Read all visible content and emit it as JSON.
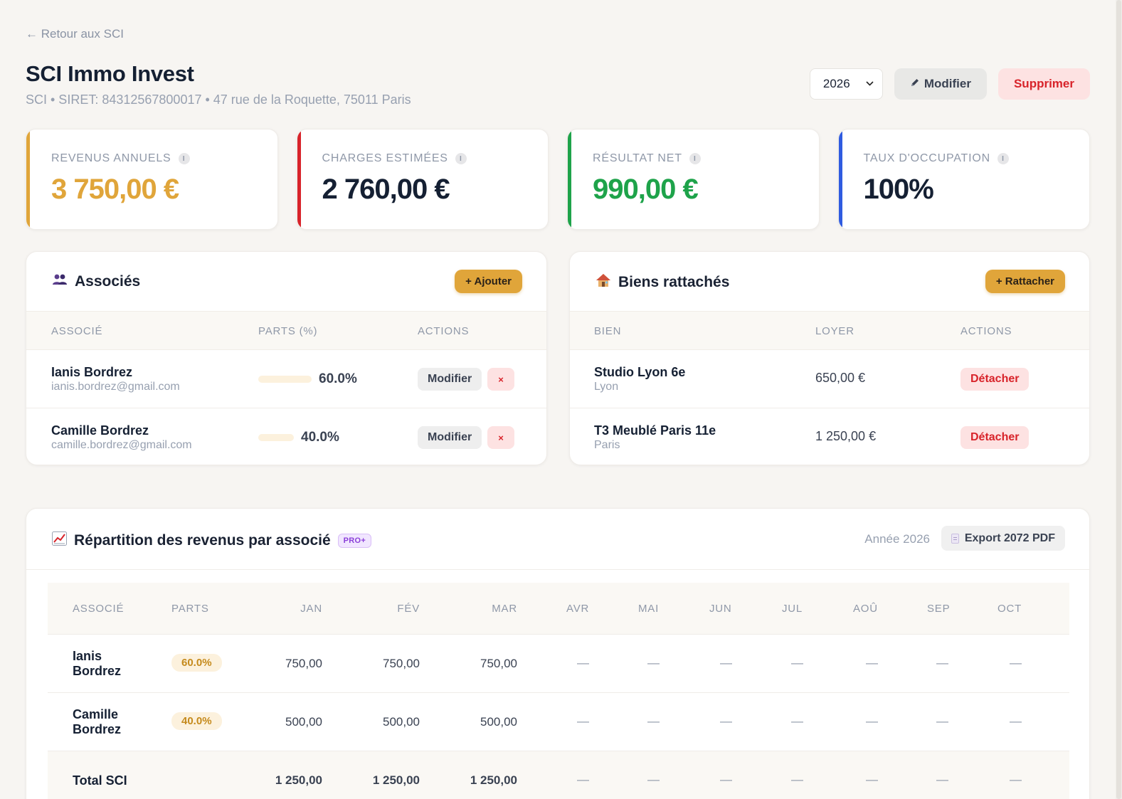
{
  "nav": {
    "back_label": "← Retour aux SCI"
  },
  "header": {
    "title": "SCI Immo Invest",
    "subtitle": "SCI • SIRET: 84312567800017 • 47 rue de la Roquette, 75011 Paris",
    "year_selected": "2026",
    "edit_label": "Modifier",
    "delete_label": "Supprimer"
  },
  "kpis": [
    {
      "label": "Revenus annuels",
      "value": "3 750,00 €",
      "accent": "#e0a53a",
      "value_color": "#e0a53a"
    },
    {
      "label": "Charges estimées",
      "value": "2 760,00 €",
      "accent": "#d8232a",
      "value_color": "#152033"
    },
    {
      "label": "Résultat net",
      "value": "990,00 €",
      "accent": "#1ea34a",
      "value_color": "#1ea34a"
    },
    {
      "label": "Taux d'occupation",
      "value": "100%",
      "accent": "#2f5be0",
      "value_color": "#152033"
    }
  ],
  "associes": {
    "title": "Associés",
    "icon": "people-icon",
    "add_label": "+ Ajouter",
    "columns": [
      "Associé",
      "Parts (%)",
      "Actions"
    ],
    "rows": [
      {
        "name": "Ianis Bordrez",
        "email": "ianis.bordrez@gmail.com",
        "share": 60.0,
        "share_label": "60.0%",
        "edit_label": "Modifier",
        "remove_label": "×"
      },
      {
        "name": "Camille Bordrez",
        "email": "camille.bordrez@gmail.com",
        "share": 40.0,
        "share_label": "40.0%",
        "edit_label": "Modifier",
        "remove_label": "×"
      }
    ]
  },
  "biens": {
    "title": "Biens rattachés",
    "icon": "house-icon",
    "add_label": "+ Rattacher",
    "columns": [
      "Bien",
      "Loyer",
      "Actions"
    ],
    "rows": [
      {
        "name": "Studio Lyon 6e",
        "city": "Lyon",
        "rent": "650,00 €",
        "detach_label": "Détacher"
      },
      {
        "name": "T3 Meublé Paris 11e",
        "city": "Paris",
        "rent": "1 250,00 €",
        "detach_label": "Détacher"
      }
    ]
  },
  "repartition": {
    "title": "Répartition des revenus par associé",
    "icon": "chart-icon",
    "badge": "PRO+",
    "year_note": "Année 2026",
    "export_label": "Export 2072 PDF",
    "columns": [
      "Associé",
      "Parts",
      "Jan",
      "Fév",
      "Mar",
      "Avr",
      "Mai",
      "Jun",
      "Jul",
      "Aoû",
      "Sep",
      "Oct"
    ],
    "rows": [
      {
        "name": "Ianis Bordrez",
        "share": "60.0%",
        "months": [
          "750,00",
          "750,00",
          "750,00",
          "—",
          "—",
          "—",
          "—",
          "—",
          "—",
          "—"
        ]
      },
      {
        "name": "Camille Bordrez",
        "share": "40.0%",
        "months": [
          "500,00",
          "500,00",
          "500,00",
          "—",
          "—",
          "—",
          "—",
          "—",
          "—",
          "—"
        ]
      }
    ],
    "total": {
      "name": "Total SCI",
      "months": [
        "1 250,00",
        "1 250,00",
        "1 250,00",
        "—",
        "—",
        "—",
        "—",
        "—",
        "—",
        "—"
      ]
    }
  }
}
